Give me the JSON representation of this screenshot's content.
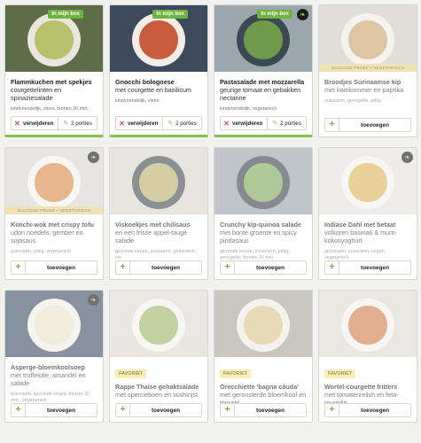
{
  "labels": {
    "in_box": "In mijn box",
    "remove": "verwijderen",
    "add": "toevoegen",
    "favorite": "FAVORIET",
    "ribbon": "GLUCOSE PROEF • VEGETARISCH"
  },
  "colors": {
    "accent": "#86c24b",
    "remove": "#e04b4b",
    "favorite_bg": "#f7e38a"
  },
  "recipes": [
    {
      "title": "Flammkuchen met spekjes",
      "subtitle": "courgettelinten en spinaziesalade",
      "meta": "kindvriendelijk, vlees, binnen 20 min.",
      "in_box": true,
      "portions": "2 porties",
      "leaf": false,
      "ribbon": false,
      "favorite": false,
      "bg": "#5c6d48",
      "plate": "#e9e6de",
      "food": "#b7c06a"
    },
    {
      "title": "Gnocchi bolognese",
      "subtitle": "met courgette en basilicum",
      "meta": "kindvriendelijk, vlees",
      "in_box": true,
      "portions": "2 porties",
      "leaf": false,
      "ribbon": false,
      "favorite": false,
      "bg": "#3d4a5e",
      "plate": "#f2eee6",
      "food": "#c85b3b"
    },
    {
      "title": "Pastasalade met mozzarella",
      "subtitle": "geurige tomaat en gebakken nectarine",
      "meta": "kindvriendelijk, vegetarisch",
      "in_box": true,
      "portions": "2 porties",
      "leaf": true,
      "ribbon": false,
      "favorite": false,
      "bg": "#9aa8ad",
      "plate": "#3b4a52",
      "food": "#6f9a4a"
    },
    {
      "title": "Broodjes Surinaamse kip",
      "subtitle": "met komkommer en paprika",
      "meta": "zuivelarm, gevogelte, pittig",
      "in_box": false,
      "portions": "",
      "leaf": false,
      "ribbon": true,
      "favorite": false,
      "bg": "#cfc9c2",
      "plate": "#f0ece4",
      "food": "#c9a36b"
    },
    {
      "title": "Kimchi-wok met crispy tofu",
      "subtitle": "udon noedels, gember en sojasaus",
      "meta": "zuivelarm, pittig, vegetarisch",
      "in_box": false,
      "portions": "",
      "leaf": true,
      "ribbon": true,
      "favorite": false,
      "bg": "#d9d6d0",
      "plate": "#f4f1ea",
      "food": "#d78a4b"
    },
    {
      "title": "Viskoekjes met chilisaus",
      "subtitle": "en een frisse appel-taugé salade",
      "meta": "gezonde keuze, zuivelarm, glutenarm, vis",
      "in_box": false,
      "portions": "",
      "leaf": false,
      "ribbon": false,
      "favorite": false,
      "bg": "#d8d3cb",
      "plate": "#444c52",
      "food": "#b9b26a"
    },
    {
      "title": "Crunchy kip-quinoa salade",
      "subtitle": "met bonte groente en spicy pindasaus",
      "meta": "gezonde keuze, zuivelarm, pittig, gevogelte, binnen 20 min.",
      "in_box": false,
      "portions": "",
      "leaf": false,
      "ribbon": false,
      "favorite": false,
      "bg": "#97a2a8",
      "plate": "#3a444b",
      "food": "#7fa65a"
    },
    {
      "title": "Indiase Dahl met betaat",
      "subtitle": "volkoren basmati & munt-kokosyoghurt",
      "meta": "glutenarm, zuivelarm, vegan, vegetarisch",
      "in_box": false,
      "portions": "",
      "leaf": true,
      "ribbon": false,
      "favorite": false,
      "bg": "#e4e0da",
      "plate": "#f4f1ea",
      "food": "#d9b55a"
    },
    {
      "title": "Asperge-bloemkoolsoep",
      "subtitle": "met truffelolie, amandel en salade",
      "meta": "zuivelarm, gezonde keuze, binnen 20 min., vegetarisch",
      "in_box": false,
      "portions": "",
      "leaf": true,
      "ribbon": false,
      "favorite": false,
      "bg": "#3e4f66",
      "plate": "#f1ede6",
      "food": "#e8e0c6"
    },
    {
      "title": "Rappe Thaise gehaktsalade",
      "subtitle": "met spercieboen en sushirijst",
      "meta": "pittig, binnen 20 min., zuivelarm, glutenarm, vlees",
      "in_box": false,
      "portions": "",
      "leaf": false,
      "ribbon": false,
      "favorite": true,
      "bg": "#dcd8d1",
      "plate": "#f4f1ea",
      "food": "#9ab76a"
    },
    {
      "title": "Orecchiette 'bagna cáuda'",
      "subtitle": "met geroosterde bloemkool en tomaat",
      "meta": "kindvriendelijk, binnen 20 min., vis",
      "in_box": false,
      "portions": "",
      "leaf": false,
      "ribbon": false,
      "favorite": true,
      "bg": "#a9a49c",
      "plate": "#efebe3",
      "food": "#d9c48a"
    },
    {
      "title": "Wortel-courgette fritters",
      "subtitle": "met tomatenrelish en feta-muntdip",
      "meta": "kindvriendelijk, vegetarisch",
      "in_box": false,
      "portions": "",
      "leaf": false,
      "ribbon": false,
      "favorite": true,
      "bg": "#ddd9d2",
      "plate": "#f4f1ea",
      "food": "#cf7f4a"
    }
  ]
}
